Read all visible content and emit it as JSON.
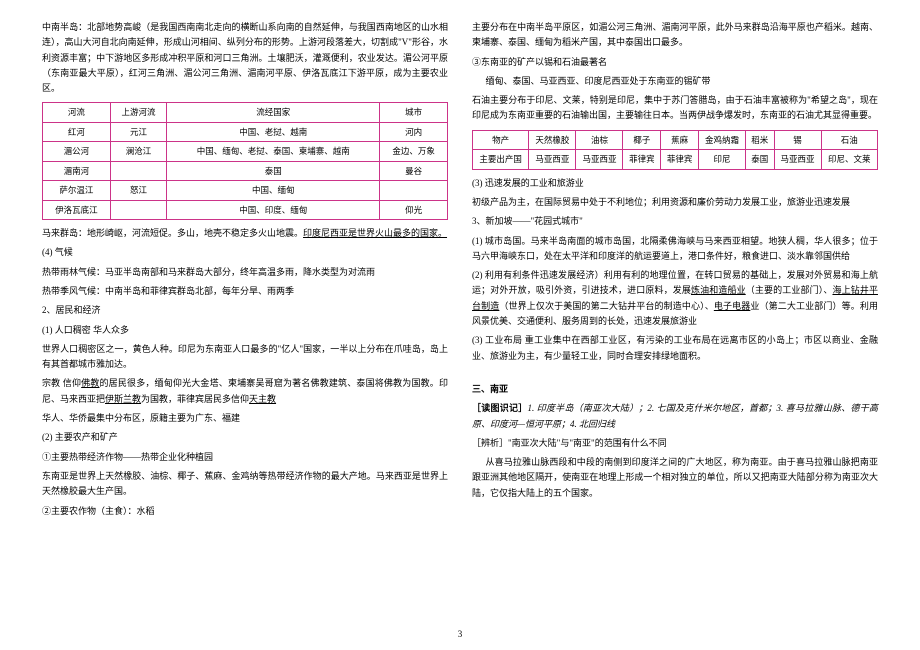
{
  "left": {
    "p1": "中南半岛：北部地势高峻（是我国西南南北走向的横断山系向南的自然延伸，与我国西南地区的山水相连），高山大河自北向南延伸，形成山河相间、纵列分布的形势。上游河段落差大，切割成\"V\"形谷，水利资源丰富；中下游地区多形成冲积平原和河口三角洲。土壤肥沃，灌溉便利，农业发达。湄公河平原（东南亚最大平原），红河三角洲、湄公河三角洲、湄南河平原、伊洛瓦底江下游平原，成为主要农业区。",
    "table1": {
      "header": [
        "河流",
        "上游河流",
        "流经国家",
        "城市"
      ],
      "rows": [
        [
          "红河",
          "元江",
          "中国、老挝、越南",
          "河内"
        ],
        [
          "湄公河",
          "澜沧江",
          "中国、缅甸、老挝、泰国、柬埔寨、越南",
          "金边、万象"
        ],
        [
          "湄南河",
          "",
          "泰国",
          "曼谷"
        ],
        [
          "萨尔温江",
          "怒江",
          "中国、缅甸",
          ""
        ],
        [
          "伊洛瓦底江",
          "",
          "中国、印度、缅甸",
          "仰光"
        ]
      ]
    },
    "p2a": "马来群岛：地形崎岖，河流短促。多山，地壳不稳定多火山地震。",
    "p2b": "印度尼西亚是世界火山最多的国家。",
    "p3": "(4) 气候",
    "p4": "热带雨林气候：马亚半岛南部和马来群岛大部分，终年高温多雨，降水类型为对流雨",
    "p5": "热带季风气候：中南半岛和菲律宾群岛北部，每年分旱、雨两季",
    "p6": "2、居民和经济",
    "p7": "(1) 人口稠密 华人众多",
    "p8": "世界人口稠密区之一，黄色人种。印尼为东南亚人口最多的\"亿人\"国家，一半以上分布在爪哇岛，岛上有其首都城市雅加达。",
    "p9a": "宗教 信仰",
    "p9b": "佛教",
    "p9c": "的居民很多，缅甸仰光大金塔、柬埔寨吴哥窟为著名佛教建筑、泰国将佛教为国教。印尼、马来西亚把",
    "p9d": "伊斯兰教",
    "p9e": "为国教，菲律宾居民多信仰",
    "p9f": "天主教",
    "p10": "华人、华侨最集中分布区，原籍主要为广东、福建",
    "p11": "(2) 主要农产和矿产",
    "p12": "①主要热带经济作物——热带企业化种植园",
    "p13": "东南亚是世界上天然橡胶、油棕、椰子、蕉麻、金鸡纳等热带经济作物的最大产地。马来西亚是世界上天然橡胶最大生产国。",
    "p14": "②主要农作物（主食）：水稻"
  },
  "right": {
    "p1": "主要分布在中南半岛平原区，如湄公河三角洲、湄南河平原，此外马来群岛沿海平原也产稻米。越南、柬埔寨、泰国、缅甸为稻米产国，其中泰国出口最多。",
    "p2": "③东南亚的矿产以锡和石油最著名",
    "p3": "缅甸、泰国、马亚西亚、印度尼西亚处于东南亚的锡矿带",
    "p4": "石油主要分布于印尼、文莱，特别是印尼，集中于苏门答腊岛，由于石油丰富被称为\"希望之岛\"，现在印尼成为东南亚重要的石油输出国，主要输往日本。当两伊战争爆发时，东南亚的石油尤其显得重要。",
    "table2": {
      "header": [
        "物产",
        "天然橡胶",
        "油棕",
        "椰子",
        "蕉麻",
        "金鸡纳霜",
        "稻米",
        "锡",
        "石油"
      ],
      "row": [
        "主要出产国",
        "马亚西亚",
        "马亚西亚",
        "菲律宾",
        "菲律宾",
        "印尼",
        "泰国",
        "马亚西亚",
        "印尼、文莱"
      ]
    },
    "p5": "(3) 迅速发展的工业和旅游业",
    "p6": "初级产品为主，在国际贸易中处于不利地位；利用资源和廉价劳动力发展工业，旅游业迅速发展",
    "p7": "3、新加坡——\"花园式城市\"",
    "p8": "(1) 城市岛国。马来半岛南面的城市岛国，北隔柔佛海峡与马来西亚相望。地狭人稠，华人很多；位于马六甲海峡东口，处在太平洋和印度洋的航运要道上，港口条件好，粮食进口、淡水靠邻国供给",
    "p9a": "(2) 利用有利条件迅速发展经济）利用有利的地理位置，在转口贸易的基础上，发展对外贸易和海上航运；对外开放，吸引外资，引进技术，进口原料，发展",
    "p9b": "炼油和造船业",
    "p9c": "（主要的工业部门）、",
    "p9d": "海上钻井平台制造",
    "p9e": "（世界上仅次于美国的第二大钻井平台的制造中心）、",
    "p9f": "电子电器",
    "p9g": "业（第二大工业部门）等。利用风景优美、交通便利、服务周到的长处，迅速发展旅游业",
    "p10": "(3) 工业布局 重工业集中在西部工业区，有污染的工业布局在远离市区的小岛上；市区以商业、金融业、旅游业为主，有少量轻工业，同时合理安排绿地面积。",
    "sec": "三、南亚",
    "mem": "［读图识记］",
    "mem_items": "1. 印度半岛（南亚次大陆）；2. 七国及克什米尔地区，首都；3. 喜马拉雅山脉、德干高原、印度河—恒河平原；4. 北回归线",
    "ana": "［辨析］\"南亚次大陆\"与\"南亚\"的范围有什么不同",
    "p11": "从喜马拉雅山脉西段和中段的南侧到印度洋之间的广大地区，称为南亚。由于喜马拉雅山脉把南亚跟亚洲其他地区隔开，使南亚在地理上形成一个相对独立的单位，所以又把南亚大陆部分称为南亚次大陆，它仅指大陆上的五个国家。"
  },
  "page": "3"
}
